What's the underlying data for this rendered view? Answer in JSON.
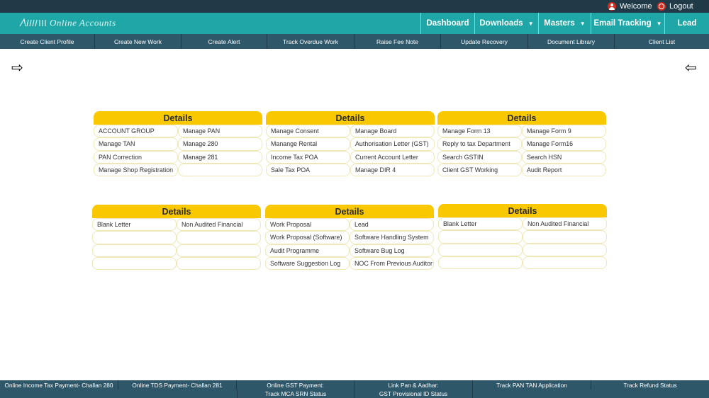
{
  "topbar": {
    "welcome": "Welcome",
    "logout": "Logout",
    "bg": "#213a47"
  },
  "navbar": {
    "logo_text": "Online Accounts",
    "items": [
      {
        "label": "Dashboard"
      },
      {
        "label": "Downloads"
      },
      {
        "label": "Masters"
      },
      {
        "label": "Email Tracking"
      },
      {
        "label": "Lead"
      }
    ],
    "bg": "#1fa6a6"
  },
  "subnav": {
    "items": [
      {
        "label": "Create Client Profile"
      },
      {
        "label": "Create New Work"
      },
      {
        "label": "Create Alert"
      },
      {
        "label": "Track Overdue Work"
      },
      {
        "label": "Raise Fee Note"
      },
      {
        "label": "Update Recovery"
      },
      {
        "label": "Document Library"
      },
      {
        "label": "Client List"
      }
    ]
  },
  "arrows": {
    "left": "⇨",
    "right": "⇦"
  },
  "panels": [
    {
      "title": "Details",
      "cells": [
        "ACCOUNT GROUP",
        "Manage PAN",
        "Manage TAN",
        "Manage 280",
        "PAN Correction",
        "Manage 281",
        "Manage Shop Registration",
        ""
      ]
    },
    {
      "title": "Details",
      "cells": [
        "Manage Consent",
        "Manage Board",
        "Manange Rental",
        "Authorisation Letter (GST)",
        "Income Tax POA",
        "Current Account Letter",
        "Sale Tax POA",
        "Manage DIR 4"
      ]
    },
    {
      "title": "Details",
      "cells": [
        "Manage Form 13",
        "Manage Form 9",
        "Reply to tax Department",
        "Manage Form16",
        "Search GSTIN",
        "Search HSN",
        "Client GST Working",
        "Audit Report"
      ]
    },
    {
      "title": "Details",
      "cells": [
        "Blank Letter",
        "Non Audited Financial",
        "",
        "",
        "",
        "",
        "",
        ""
      ]
    },
    {
      "title": "Details",
      "cells": [
        "Work Proposal",
        "Lead",
        "Work Proposal (Software)",
        "Software Handling System",
        "Audit Programme",
        "Software Bug Log",
        "Software Suggestion Log",
        "NOC From Previous Auditor"
      ]
    },
    {
      "title": "Details",
      "cells": [
        "Blank Letter",
        "Non Audited Financial",
        "",
        "",
        "",
        "",
        "",
        ""
      ]
    }
  ],
  "footer": {
    "row1": [
      {
        "label": "Online Income Tax Payment- Challan 280"
      },
      {
        "label": "Online TDS Payment- Challan 281"
      },
      {
        "label": "Online GST Payment:"
      },
      {
        "label": "Link Pan & Aadhar:"
      },
      {
        "label": "Track PAN TAN Application"
      },
      {
        "label": "Track Refund Status"
      }
    ],
    "row2": [
      {
        "label": "Track MCA SRN Status"
      },
      {
        "label": "GST Provisional ID Status"
      }
    ]
  },
  "colors": {
    "panel_header": "#f9c800",
    "subnav_bg": "#2e5769"
  }
}
